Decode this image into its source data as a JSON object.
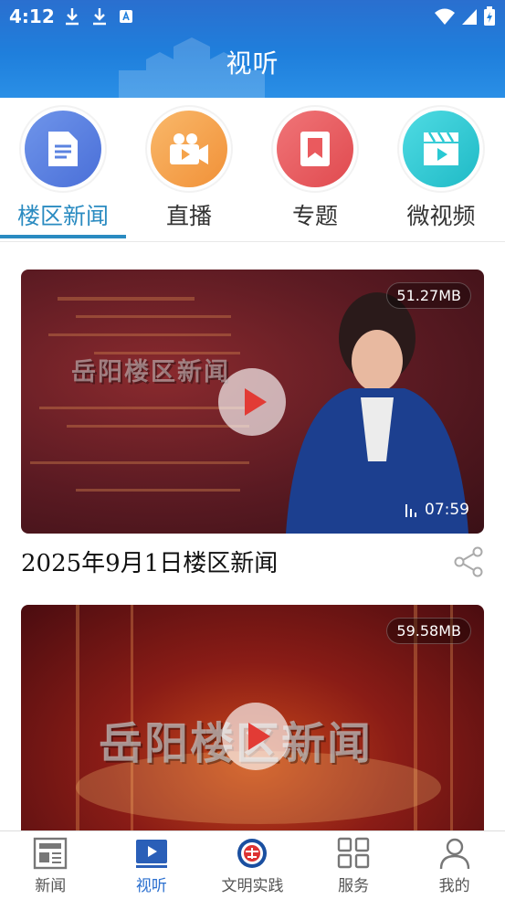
{
  "status_bar": {
    "time": "4:12"
  },
  "header": {
    "title": "视听"
  },
  "categories": [
    {
      "label": "楼区新闻",
      "icon": "document-icon",
      "color": "#5b83e0",
      "active": true
    },
    {
      "label": "直播",
      "icon": "video-camera-icon",
      "color": "#f5a34a",
      "active": false
    },
    {
      "label": "专题",
      "icon": "bookmark-icon",
      "color": "#ea5a5e",
      "active": false
    },
    {
      "label": "微视频",
      "icon": "film-clapper-icon",
      "color": "#29c9d3",
      "active": false
    }
  ],
  "videos": [
    {
      "title": "2025年9月1日楼区新闻",
      "size": "51.27MB",
      "duration": "07:59",
      "watermark": "岳阳楼区新闻"
    },
    {
      "title": "",
      "size": "59.58MB",
      "watermark": "岳阳楼区新闻"
    }
  ],
  "bottom_nav": [
    {
      "label": "新闻",
      "icon": "newspaper-icon",
      "active": false
    },
    {
      "label": "视听",
      "icon": "video-player-icon",
      "active": true
    },
    {
      "label": "文明实践",
      "icon": "civilization-emblem-icon",
      "active": false
    },
    {
      "label": "服务",
      "icon": "grid-icon",
      "active": false
    },
    {
      "label": "我的",
      "icon": "person-icon",
      "active": false
    }
  ],
  "colors": {
    "header": "#1f7fdc",
    "accent": "#2a8bc1",
    "nav_active": "#2a6fcf",
    "play": "#e23b35"
  }
}
